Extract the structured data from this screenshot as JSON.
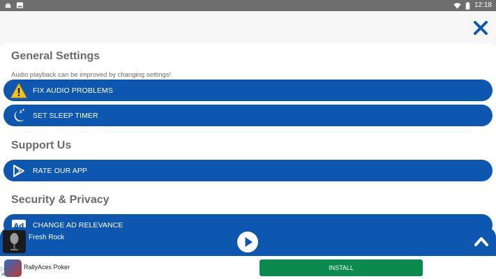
{
  "statusbar": {
    "time": "12:18",
    "left_icons": [
      "android-notification-icon",
      "image-notification-icon"
    ],
    "right_icons": [
      "wifi-icon",
      "battery-icon"
    ]
  },
  "colors": {
    "accent": "#0d57b0",
    "install_green": "#0b8a4f",
    "status_bar": "#6e6e6e",
    "section_text": "#6b6b6b"
  },
  "header": {
    "close_icon": "close-icon"
  },
  "sections": {
    "general": {
      "title": "General Settings",
      "subtitle": "Audio playback can be improved by changing settings!",
      "items": [
        {
          "label": "FIX AUDIO PROBLEMS",
          "icon": "warning-icon"
        },
        {
          "label": "SET SLEEP TIMER",
          "icon": "moon-sleep-icon"
        }
      ]
    },
    "support": {
      "title": "Support Us",
      "items": [
        {
          "label": "RATE OUR APP",
          "icon": "play-store-icon"
        }
      ]
    },
    "security": {
      "title": "Security & Privacy",
      "items": [
        {
          "label": "CHANGE AD RELEVANCE",
          "icon": "ad-icon"
        }
      ]
    }
  },
  "player": {
    "station": "Fresh Rock",
    "album_art_icon": "microphone-icon",
    "play_icon": "play-icon",
    "expand_icon": "chevron-up-icon"
  },
  "ad": {
    "app_name": "RallyAces Poker",
    "install_label": "INSTALL"
  }
}
